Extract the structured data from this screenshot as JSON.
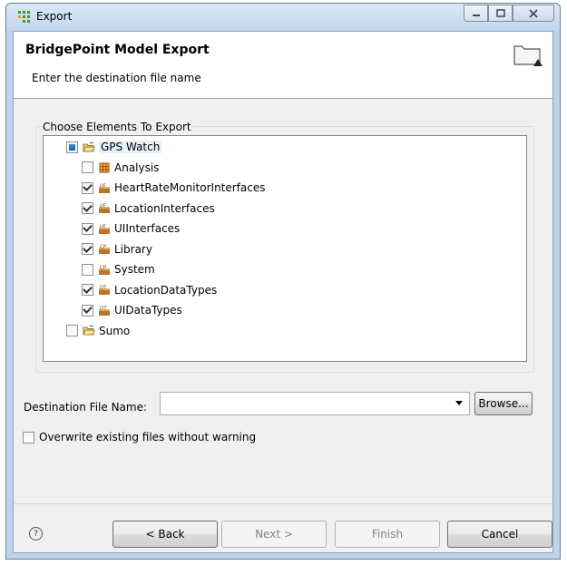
{
  "window": {
    "title": "Export"
  },
  "banner": {
    "title": "BridgePoint Model Export",
    "subtitle": "Enter the destination file name",
    "icon": "folder-icon"
  },
  "group": {
    "legend": "Choose Elements To Export"
  },
  "tree": [
    {
      "label": "GPS Watch",
      "state": "partial",
      "icon": "project-folder-icon",
      "selected": true
    },
    {
      "label": "Analysis",
      "state": "unchecked",
      "icon": "package-grid-icon"
    },
    {
      "label": "HeartRateMonitorInterfaces",
      "state": "checked",
      "icon": "interface-package-icon"
    },
    {
      "label": "LocationInterfaces",
      "state": "checked",
      "icon": "interface-package-icon"
    },
    {
      "label": "UIInterfaces",
      "state": "checked",
      "icon": "interface-package-icon"
    },
    {
      "label": "Library",
      "state": "checked",
      "icon": "component-package-icon"
    },
    {
      "label": "System",
      "state": "unchecked",
      "icon": "component-package-icon"
    },
    {
      "label": "LocationDataTypes",
      "state": "checked",
      "icon": "datatype-package-icon"
    },
    {
      "label": "UIDataTypes",
      "state": "checked",
      "icon": "datatype-package-icon"
    },
    {
      "label": "Sumo",
      "state": "unchecked",
      "icon": "project-folder-icon"
    }
  ],
  "destination": {
    "label": "Destination File Name:",
    "value": "",
    "browse": "Browse..."
  },
  "overwrite": {
    "label": "Overwrite existing files without warning",
    "checked": false
  },
  "buttons": {
    "back": "< Back",
    "next": "Next >",
    "finish": "Finish",
    "cancel": "Cancel"
  },
  "colors": {
    "accent": "#1c5fa8",
    "titlebar": "#c3d7ed"
  }
}
